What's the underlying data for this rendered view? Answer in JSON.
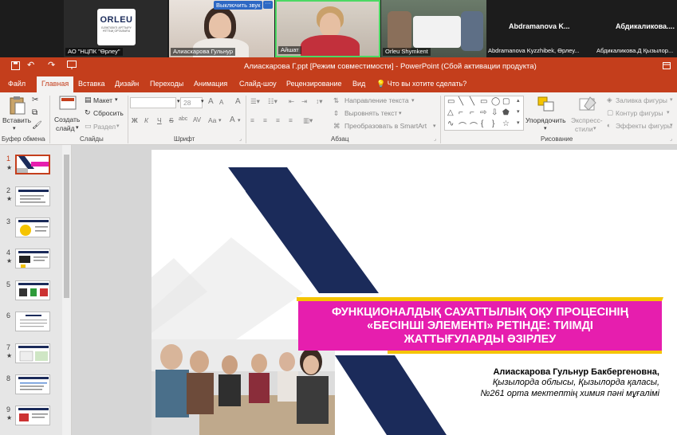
{
  "meeting": {
    "tiles": [
      {
        "name": "АО \"НЦПК \"Өрлеу\""
      },
      {
        "name": "Алиаскарова Гульнур",
        "mute_label": "Выключить звук",
        "more_label": "···"
      },
      {
        "name": "Айшат"
      },
      {
        "name": "Orleu Shymkent"
      }
    ],
    "logo_text": "ORLEU",
    "logo_subtext": "БІЛІКТІЛІКТІ АРТТЫРУ ҰЛТТЫҚ ОРТАЛЫҒЫ",
    "name_tiles": [
      {
        "name": "Abdramanova K...",
        "subname": "Abdramanova Kyzzhibek, Өрлеу..."
      },
      {
        "name": "Абдикаликова....",
        "subname": "Абдикаликова.Д Қызылор..."
      }
    ]
  },
  "window": {
    "title": "Алиаскарова Г.ppt [Режим совместимости] - PowerPoint (Сбой активации продукта)",
    "qa_icons": [
      "save-icon",
      "undo-icon",
      "redo-icon",
      "slideshow-icon"
    ]
  },
  "tabs": [
    {
      "label": "Файл",
      "active": false
    },
    {
      "label": "Главная",
      "active": true
    },
    {
      "label": "Вставка",
      "active": false
    },
    {
      "label": "Дизайн",
      "active": false
    },
    {
      "label": "Переходы",
      "active": false
    },
    {
      "label": "Анимация",
      "active": false
    },
    {
      "label": "Слайд-шоу",
      "active": false
    },
    {
      "label": "Рецензирование",
      "active": false
    },
    {
      "label": "Вид",
      "active": false
    }
  ],
  "tell_me": "Что вы хотите сделать?",
  "ribbon": {
    "clipboard": {
      "paste": "Вставить",
      "group": "Буфер обмена"
    },
    "slides": {
      "new_slide_1": "Создать",
      "new_slide_2": "слайд",
      "layout": "Макет",
      "reset": "Сбросить",
      "section": "Раздел",
      "group": "Слайды"
    },
    "font": {
      "size": "28",
      "bold": "Ж",
      "italic": "К",
      "underline": "Ч",
      "strike": "S",
      "shadow": "abc",
      "spacing": "AV",
      "case": "Aa",
      "color": "A",
      "grow": "A",
      "shrink": "A",
      "clear": "A",
      "group": "Шрифт"
    },
    "paragraph": {
      "direction": "Направление текста",
      "align_text": "Выровнять текст",
      "smartart": "Преобразовать в SmartArt",
      "group": "Абзац"
    },
    "drawing": {
      "arrange_1": "Упорядочить",
      "styles_1": "Экспресс-",
      "styles_2": "стили",
      "fill": "Заливка фигуры",
      "outline": "Контур фигуры",
      "effects": "Эффекты фигуры",
      "group": "Рисование"
    }
  },
  "thumbnails": [
    {
      "num": "1",
      "star": "★",
      "active": true
    },
    {
      "num": "2",
      "star": "★",
      "active": false
    },
    {
      "num": "3",
      "star": "",
      "active": false
    },
    {
      "num": "4",
      "star": "★",
      "active": false
    },
    {
      "num": "5",
      "star": "",
      "active": false
    },
    {
      "num": "6",
      "star": "",
      "active": false
    },
    {
      "num": "7",
      "star": "★",
      "active": false
    },
    {
      "num": "8",
      "star": "",
      "active": false
    },
    {
      "num": "9",
      "star": "★",
      "active": false
    }
  ],
  "slide": {
    "title_lines": [
      "ФУНКЦИОНАЛДЫҚ САУАТТЫЛЫҚ ОҚУ ПРОЦЕСІНІҢ",
      "«БЕСІНШІ ЭЛЕМЕНТІ» РЕТІНДЕ: ТИІМДІ",
      "ЖАТТЫҒУЛАРДЫ ӘЗІРЛЕУ"
    ],
    "author_name": "Алиаскарова Гульнур Бакбергеновна,",
    "author_line2": "Қызылорда облысы, Қызылорда қаласы,",
    "author_line3": "№261 орта мектептің химия пәні мұғалімі"
  },
  "colors": {
    "accent": "#c43e1c",
    "title_bg": "#e61eae",
    "navy": "#1b2b5a",
    "yellow": "#f5c400"
  }
}
